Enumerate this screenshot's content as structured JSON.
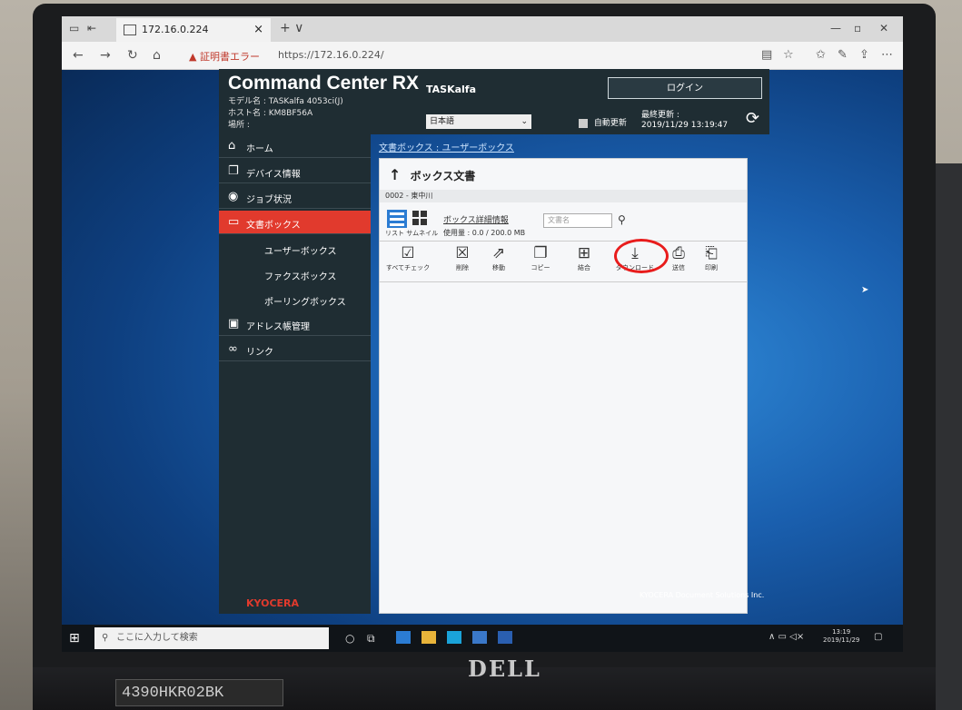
{
  "browser": {
    "tab_title": "172.16.0.224",
    "tab_close": "×",
    "new_tab": "+  ∨",
    "cert_error": "▲ 証明書エラー",
    "url": "https://172.16.0.224/"
  },
  "header": {
    "title": "Command Center RX",
    "model": "モデル名 : TASKalfa 4053ci(J)",
    "host": "ホスト名 : KM8BF56A",
    "place": "場所 :",
    "brand": "TASKalfa",
    "language": "日本語",
    "login": "ログイン",
    "auto_refresh": "自動更新",
    "last_update_label": "最終更新 :",
    "last_update_value": "2019/11/29 13:19:47"
  },
  "sidebar": {
    "items": [
      {
        "label": "ホーム"
      },
      {
        "label": "デバイス情報"
      },
      {
        "label": "ジョブ状況"
      },
      {
        "label": "文書ボックス"
      },
      {
        "label": "ユーザーボックス"
      },
      {
        "label": "ファクスボックス"
      },
      {
        "label": "ポーリングボックス"
      },
      {
        "label": "アドレス帳管理"
      },
      {
        "label": "リンク"
      }
    ],
    "logo": "KYOCERA"
  },
  "main": {
    "breadcrumb": "文書ボックス : ユーザーボックス",
    "panel_title": "ボックス文書",
    "box_path": "0002 - 東中川",
    "view_label": "リスト サムネイル",
    "detail_link": "ボックス詳細情報",
    "usage": "使用量 : 0.0 / 200.0 MB",
    "search_placeholder": "文書名",
    "tools": [
      "すべてチェック",
      "削除",
      "移動",
      "コピー",
      "結合",
      "ダウンロード",
      "送信",
      "印刷"
    ]
  },
  "footer": "KYOCERA Document Solutions Inc.",
  "taskbar": {
    "search_placeholder": "ここに入力して検索",
    "time": "13:19",
    "date": "2019/11/29"
  },
  "hardware": {
    "monitor_brand": "DELL",
    "asset_tag": "4390HKR02BK"
  }
}
